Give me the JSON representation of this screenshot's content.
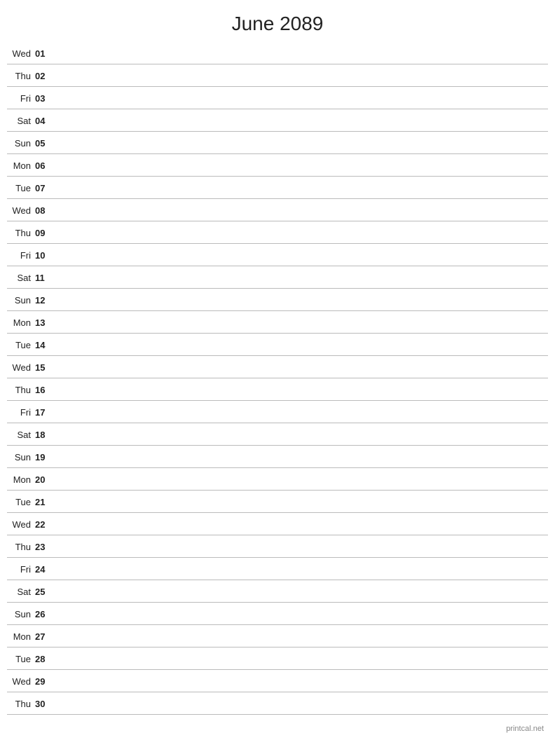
{
  "title": "June 2089",
  "days": [
    {
      "name": "Wed",
      "num": "01"
    },
    {
      "name": "Thu",
      "num": "02"
    },
    {
      "name": "Fri",
      "num": "03"
    },
    {
      "name": "Sat",
      "num": "04"
    },
    {
      "name": "Sun",
      "num": "05"
    },
    {
      "name": "Mon",
      "num": "06"
    },
    {
      "name": "Tue",
      "num": "07"
    },
    {
      "name": "Wed",
      "num": "08"
    },
    {
      "name": "Thu",
      "num": "09"
    },
    {
      "name": "Fri",
      "num": "10"
    },
    {
      "name": "Sat",
      "num": "11"
    },
    {
      "name": "Sun",
      "num": "12"
    },
    {
      "name": "Mon",
      "num": "13"
    },
    {
      "name": "Tue",
      "num": "14"
    },
    {
      "name": "Wed",
      "num": "15"
    },
    {
      "name": "Thu",
      "num": "16"
    },
    {
      "name": "Fri",
      "num": "17"
    },
    {
      "name": "Sat",
      "num": "18"
    },
    {
      "name": "Sun",
      "num": "19"
    },
    {
      "name": "Mon",
      "num": "20"
    },
    {
      "name": "Tue",
      "num": "21"
    },
    {
      "name": "Wed",
      "num": "22"
    },
    {
      "name": "Thu",
      "num": "23"
    },
    {
      "name": "Fri",
      "num": "24"
    },
    {
      "name": "Sat",
      "num": "25"
    },
    {
      "name": "Sun",
      "num": "26"
    },
    {
      "name": "Mon",
      "num": "27"
    },
    {
      "name": "Tue",
      "num": "28"
    },
    {
      "name": "Wed",
      "num": "29"
    },
    {
      "name": "Thu",
      "num": "30"
    }
  ],
  "footer": "printcal.net"
}
